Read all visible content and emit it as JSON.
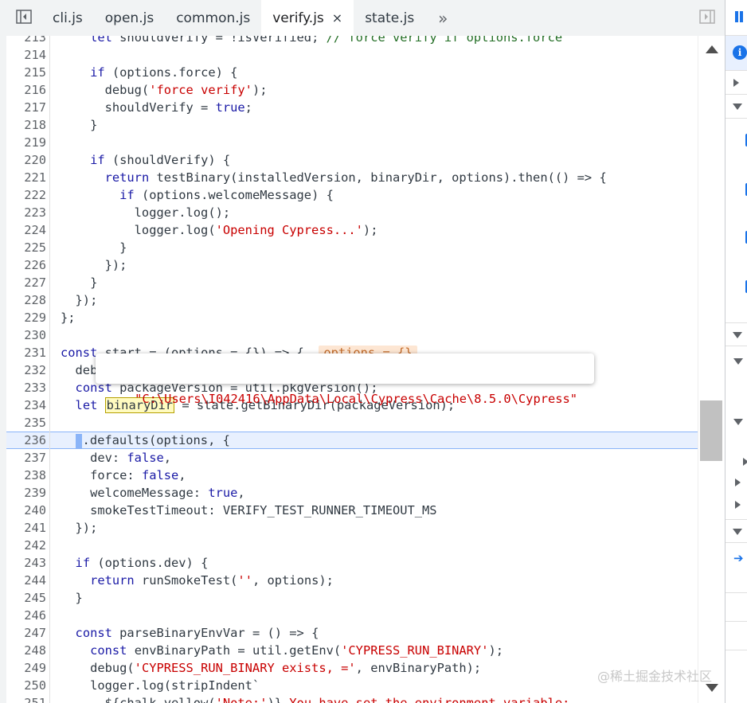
{
  "tabs": [
    {
      "label": "cli.js",
      "active": false
    },
    {
      "label": "open.js",
      "active": false
    },
    {
      "label": "common.js",
      "active": false
    },
    {
      "label": "verify.js",
      "active": true
    },
    {
      "label": "state.js",
      "active": false
    }
  ],
  "tab_close_glyph": "×",
  "tab_more_glyph": "»",
  "editor": {
    "lines": [
      {
        "num": "213",
        "html": "    <span class=\"kw\">let</span> shouldVerify = !isVerified; <span class=\"cm\">// force verify if options.force</span>"
      },
      {
        "num": "214",
        "html": ""
      },
      {
        "num": "215",
        "html": "    <span class=\"kw\">if</span> (options.force) {"
      },
      {
        "num": "216",
        "html": "      debug(<span class=\"str\">'force verify'</span>);"
      },
      {
        "num": "217",
        "html": "      shouldVerify = <span class=\"bool\">true</span>;"
      },
      {
        "num": "218",
        "html": "    }"
      },
      {
        "num": "219",
        "html": ""
      },
      {
        "num": "220",
        "html": "    <span class=\"kw\">if</span> (shouldVerify) {"
      },
      {
        "num": "221",
        "html": "      <span class=\"kw\">return</span> testBinary(installedVersion, binaryDir, options).then(() => {"
      },
      {
        "num": "222",
        "html": "        <span class=\"kw\">if</span> (options.welcomeMessage) {"
      },
      {
        "num": "223",
        "html": "          logger.log();"
      },
      {
        "num": "224",
        "html": "          logger.log(<span class=\"str\">'Opening Cypress...'</span>);"
      },
      {
        "num": "225",
        "html": "        }"
      },
      {
        "num": "226",
        "html": "      });"
      },
      {
        "num": "227",
        "html": "    }"
      },
      {
        "num": "228",
        "html": "  });"
      },
      {
        "num": "229",
        "html": "};"
      },
      {
        "num": "230",
        "html": ""
      },
      {
        "num": "231",
        "html": "<span class=\"kw\">const</span> start = (options = {}) => {  <span class=\"inline-val\">options = {}</span>"
      },
      {
        "num": "232",
        "html": "  debug(<span class=\"str\">'verifying Cypress app'</span>);"
      },
      {
        "num": "233",
        "html": "  <span class=\"kw\">const</span> packageVersion = util.pkgVersion();"
      },
      {
        "num": "234",
        "html": "  <span class=\"kw\">let</span> <span class=\"hl-box\">binaryDir</span> = state.getBinaryDir(packageVersion);"
      },
      {
        "num": "235",
        "html": ""
      },
      {
        "num": "236",
        "html": "  <span class=\"cursor-block\"></span>.defaults(options, {",
        "current": true
      },
      {
        "num": "237",
        "html": "    dev: <span class=\"bool\">false</span>,"
      },
      {
        "num": "238",
        "html": "    force: <span class=\"bool\">false</span>,"
      },
      {
        "num": "239",
        "html": "    welcomeMessage: <span class=\"bool\">true</span>,"
      },
      {
        "num": "240",
        "html": "    smokeTestTimeout: VERIFY_TEST_RUNNER_TIMEOUT_MS"
      },
      {
        "num": "241",
        "html": "  });"
      },
      {
        "num": "242",
        "html": ""
      },
      {
        "num": "243",
        "html": "  <span class=\"kw\">if</span> (options.dev) {"
      },
      {
        "num": "244",
        "html": "    <span class=\"kw\">return</span> runSmokeTest(<span class=\"str\">''</span>, options);"
      },
      {
        "num": "245",
        "html": "  }"
      },
      {
        "num": "246",
        "html": ""
      },
      {
        "num": "247",
        "html": "  <span class=\"kw\">const</span> parseBinaryEnvVar = () => {"
      },
      {
        "num": "248",
        "html": "    <span class=\"kw\">const</span> envBinaryPath = util.getEnv(<span class=\"str\">'CYPRESS_RUN_BINARY'</span>);"
      },
      {
        "num": "249",
        "html": "    debug(<span class=\"str\">'CYPRESS_RUN_BINARY exists, ='</span>, envBinaryPath);"
      },
      {
        "num": "250",
        "html": "    logger.log(stripIndent`"
      },
      {
        "num": "251",
        "html": "      ${chalk.yellow(<span class=\"str\">'Note:'</span>)} <span class=\"str\">You have set the environment variable:</span>"
      }
    ]
  },
  "tooltip": {
    "value": "\"C:\\Users\\I042416\\AppData\\Local\\Cypress\\Cache\\8.5.0\\Cypress\""
  },
  "watermark": "@稀土掘金技术社区",
  "icons": {
    "left_toggle": "sidebar-toggle-icon",
    "right_toggle": "debugger-toggle-icon",
    "pause": "pause-icon",
    "info": "info-icon"
  },
  "right_panel_info_glyph": "i"
}
